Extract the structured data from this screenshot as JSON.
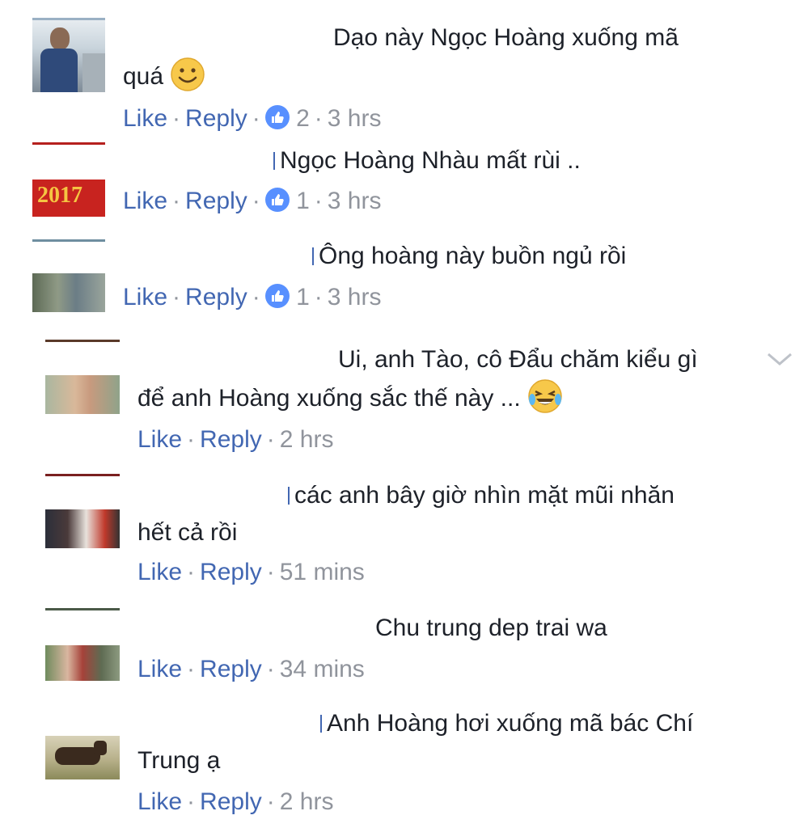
{
  "comments": [
    {
      "text_line1": "Dạo này Ngọc Hoàng xuống mã",
      "text_line2": "quá",
      "emoji": "smile-emoji",
      "like": "Like",
      "reply": "Reply",
      "reactions": "2",
      "time": "3 hrs"
    },
    {
      "text_line1": "Ngọc Hoàng Nhàu mất rùi ..",
      "like": "Like",
      "reply": "Reply",
      "reactions": "1",
      "time": "3 hrs"
    },
    {
      "text_line1": "Ông hoàng này buồn ngủ rồi",
      "like": "Like",
      "reply": "Reply",
      "reactions": "1",
      "time": "3 hrs"
    },
    {
      "text_line1": "Ui, anh Tào, cô Đẩu chăm kiểu gì",
      "text_line2": "để anh Hoàng xuống sắc thế này ...",
      "emoji": "laughing-tears-emoji",
      "like": "Like",
      "reply": "Reply",
      "time": "2 hrs"
    },
    {
      "text_line1": "các anh bây giờ nhìn mặt mũi nhăn",
      "text_line2": "hết cả rồi",
      "like": "Like",
      "reply": "Reply",
      "time": "51 mins"
    },
    {
      "text_line1": "Chu trung dep trai wa",
      "like": "Like",
      "reply": "Reply",
      "time": "34 mins"
    },
    {
      "text_line1": "Anh Hoàng hơi xuống mã bác Chí",
      "text_line2": "Trung ạ",
      "like": "Like",
      "reply": "Reply",
      "time": "2 hrs"
    }
  ],
  "separator": "·",
  "icons": {
    "reaction": "like-thumb-icon",
    "menu": "chevron-down-icon"
  },
  "colors": {
    "link": "#4267b2",
    "meta": "#90949c",
    "text": "#1d2129",
    "reaction": "#5890ff"
  }
}
